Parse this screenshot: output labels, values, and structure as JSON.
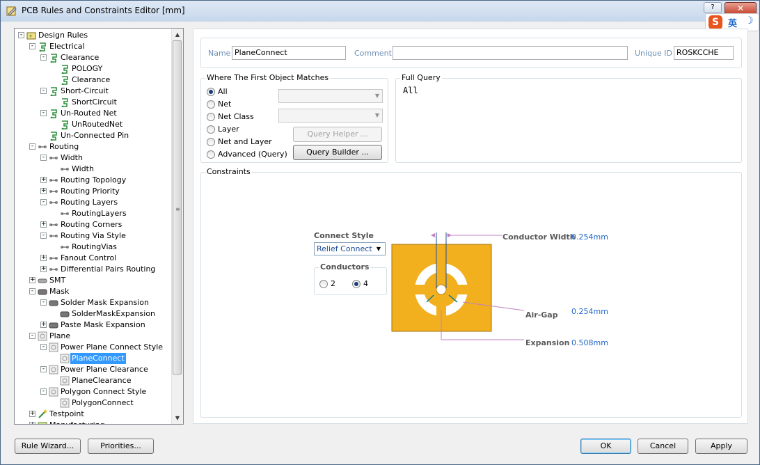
{
  "window": {
    "title": "PCB Rules and Constraints Editor [mm]",
    "help_label": "?",
    "close_label": "✕",
    "ime": {
      "logo": "S",
      "lang": "英",
      "moon": "☽"
    }
  },
  "tree": {
    "items": [
      {
        "label": "Design Rules",
        "level": 0,
        "exp": "-",
        "icon": "rules-root"
      },
      {
        "label": "Electrical",
        "level": 1,
        "exp": "-",
        "icon": "electrical"
      },
      {
        "label": "Clearance",
        "level": 2,
        "exp": "-",
        "icon": "electrical"
      },
      {
        "label": "POLOGY",
        "level": 3,
        "exp": "",
        "icon": "electrical"
      },
      {
        "label": "Clearance",
        "level": 3,
        "exp": "",
        "icon": "electrical"
      },
      {
        "label": "Short-Circuit",
        "level": 2,
        "exp": "-",
        "icon": "electrical"
      },
      {
        "label": "ShortCircuit",
        "level": 3,
        "exp": "",
        "icon": "electrical"
      },
      {
        "label": "Un-Routed Net",
        "level": 2,
        "exp": "-",
        "icon": "electrical"
      },
      {
        "label": "UnRoutedNet",
        "level": 3,
        "exp": "",
        "icon": "electrical"
      },
      {
        "label": "Un-Connected Pin",
        "level": 2,
        "exp": "",
        "icon": "electrical"
      },
      {
        "label": "Routing",
        "level": 1,
        "exp": "-",
        "icon": "routing"
      },
      {
        "label": "Width",
        "level": 2,
        "exp": "-",
        "icon": "routing"
      },
      {
        "label": "Width",
        "level": 3,
        "exp": "",
        "icon": "routing"
      },
      {
        "label": "Routing Topology",
        "level": 2,
        "exp": "+",
        "icon": "routing"
      },
      {
        "label": "Routing Priority",
        "level": 2,
        "exp": "+",
        "icon": "routing"
      },
      {
        "label": "Routing Layers",
        "level": 2,
        "exp": "-",
        "icon": "routing"
      },
      {
        "label": "RoutingLayers",
        "level": 3,
        "exp": "",
        "icon": "routing"
      },
      {
        "label": "Routing Corners",
        "level": 2,
        "exp": "+",
        "icon": "routing"
      },
      {
        "label": "Routing Via Style",
        "level": 2,
        "exp": "-",
        "icon": "routing"
      },
      {
        "label": "RoutingVias",
        "level": 3,
        "exp": "",
        "icon": "routing"
      },
      {
        "label": "Fanout Control",
        "level": 2,
        "exp": "+",
        "icon": "routing"
      },
      {
        "label": "Differential Pairs Routing",
        "level": 2,
        "exp": "+",
        "icon": "routing"
      },
      {
        "label": "SMT",
        "level": 1,
        "exp": "+",
        "icon": "smt"
      },
      {
        "label": "Mask",
        "level": 1,
        "exp": "-",
        "icon": "mask"
      },
      {
        "label": "Solder Mask Expansion",
        "level": 2,
        "exp": "-",
        "icon": "mask"
      },
      {
        "label": "SolderMaskExpansion",
        "level": 3,
        "exp": "",
        "icon": "mask"
      },
      {
        "label": "Paste Mask Expansion",
        "level": 2,
        "exp": "+",
        "icon": "mask"
      },
      {
        "label": "Plane",
        "level": 1,
        "exp": "-",
        "icon": "plane"
      },
      {
        "label": "Power Plane Connect Style",
        "level": 2,
        "exp": "-",
        "icon": "plane"
      },
      {
        "label": "PlaneConnect",
        "level": 3,
        "exp": "",
        "icon": "plane",
        "selected": true
      },
      {
        "label": "Power Plane Clearance",
        "level": 2,
        "exp": "-",
        "icon": "plane"
      },
      {
        "label": "PlaneClearance",
        "level": 3,
        "exp": "",
        "icon": "plane"
      },
      {
        "label": "Polygon Connect Style",
        "level": 2,
        "exp": "-",
        "icon": "plane"
      },
      {
        "label": "PolygonConnect",
        "level": 3,
        "exp": "",
        "icon": "plane"
      },
      {
        "label": "Testpoint",
        "level": 1,
        "exp": "+",
        "icon": "testpoint"
      },
      {
        "label": "Manufacturing",
        "level": 1,
        "exp": "+",
        "icon": "manufacturing"
      }
    ]
  },
  "header": {
    "name_label": "Name",
    "name_value": "PlaneConnect",
    "comment_label": "Comment",
    "comment_value": "",
    "uid_label": "Unique ID",
    "uid_value": "ROSKCCHE"
  },
  "where": {
    "title": "Where The First Object Matches",
    "options": [
      "All",
      "Net",
      "Net Class",
      "Layer",
      "Net and Layer",
      "Advanced (Query)"
    ],
    "selected": "All",
    "query_helper": "Query Helper ...",
    "query_builder": "Query Builder ..."
  },
  "full_query": {
    "title": "Full Query",
    "text": "All"
  },
  "constraints": {
    "title": "Constraints",
    "connect_style_label": "Connect Style",
    "connect_style_value": "Relief Connect",
    "conductors_label": "Conductors",
    "conductor_options": [
      "2",
      "4"
    ],
    "conductor_selected": "4",
    "conductor_width_label": "Conductor Width",
    "conductor_width_value": "0.254mm",
    "air_gap_label": "Air-Gap",
    "air_gap_value": "0.254mm",
    "expansion_label": "Expansion",
    "expansion_value": "0.508mm",
    "colors": {
      "copper": "#f2b01e",
      "gap": "#ffffff",
      "dim_line": "#c080c0",
      "conductor_line": "#1f4e9a",
      "arrow": "#1f7a8a"
    }
  },
  "footer": {
    "rule_wizard": "Rule Wizard...",
    "priorities": "Priorities...",
    "ok": "OK",
    "cancel": "Cancel",
    "apply": "Apply"
  }
}
